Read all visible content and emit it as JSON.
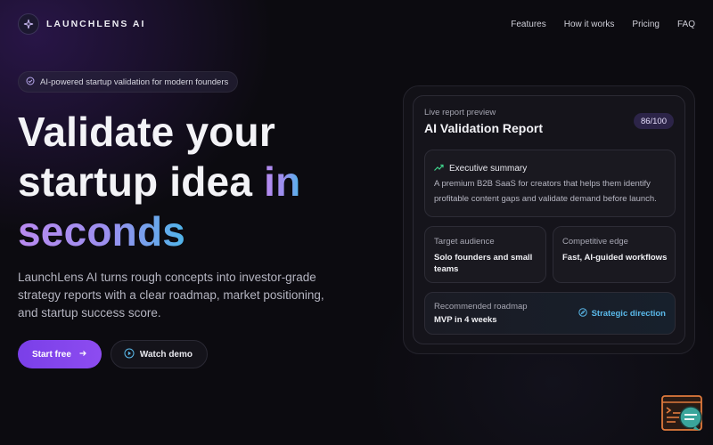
{
  "nav": {
    "brand": "LAUNCHLENS AI",
    "links": [
      "Features",
      "How it works",
      "Pricing",
      "FAQ"
    ]
  },
  "hero": {
    "pill_text": "AI-powered startup validation for modern founders",
    "headline_line1": "Validate your",
    "headline_line2": "startup idea",
    "headline_accent_in": "in",
    "headline_accent_seconds": "seconds",
    "subtext": "LaunchLens AI turns rough concepts into investor-grade strategy reports with a clear roadmap, market positioning, and startup success score.",
    "primary_cta": "Start free",
    "secondary_cta": "Watch demo"
  },
  "report": {
    "label": "Live report preview",
    "title": "AI Validation Report",
    "score": "86/100",
    "summary_title": "Executive summary",
    "summary_text": "A premium B2B SaaS for creators that helps them identify profitable content gaps and validate demand before launch.",
    "audience_label": "Target audience",
    "audience_value": "Solo founders and small teams",
    "edge_label": "Competitive edge",
    "edge_value": "Fast, AI-guided workflows",
    "roadmap_label": "Recommended roadmap",
    "roadmap_value": "MVP in 4 weeks",
    "roadmap_link": "Strategic direction"
  },
  "icons": {
    "brand": "sparkle-icon",
    "pill": "check-circle-icon",
    "primary_cta": "arrow-right-icon",
    "secondary_cta": "play-circle-icon",
    "summary": "trend-up-icon",
    "roadmap_link": "compass-icon",
    "corner": "terminal-chat-icon"
  },
  "colors": {
    "accent_purple": "#7a3fe8",
    "accent_cyan": "#5ab9ea",
    "trend_green": "#3fd18a",
    "corner_orange": "#e07a3c",
    "corner_teal": "#3aa59b",
    "background": "#0c0b10"
  }
}
